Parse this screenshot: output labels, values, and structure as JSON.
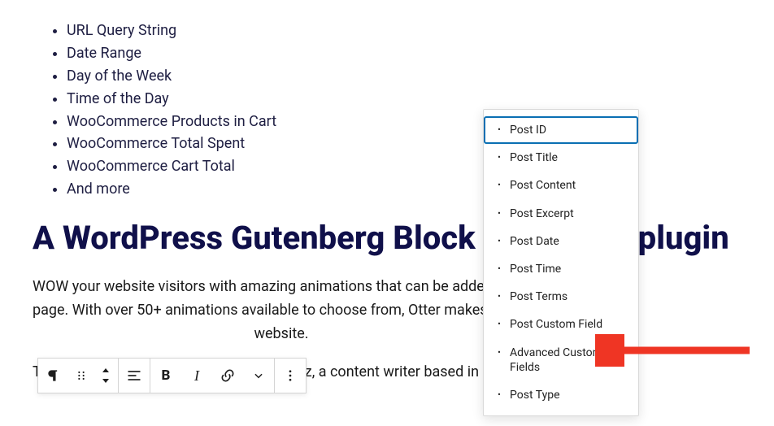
{
  "features": [
    "URL Query String",
    "Date Range",
    "Day of the Week",
    "Time of the Day",
    "WooCommerce Products in Cart",
    "WooCommerce Total Spent",
    "WooCommerce Cart Total",
    "And more"
  ],
  "heading": "A WordPress Gutenberg Block animation plugin",
  "para_line1": "WOW your website visitors with amazing animations that can be added ",
  "para_line2": "page. With over 50+ animations available to choose from, Otter makes i",
  "para_line3": "website.",
  "para2": "This article was written by Pablo Rodriguez, a content writer based in %",
  "toolbar": {
    "block_type": "Paragraph",
    "drag": "Drag",
    "move": "Move up/down",
    "align": "Align",
    "bold": "B",
    "italic": "I",
    "link": "Link",
    "more_rich": "More rich text",
    "options": "Options"
  },
  "popover": {
    "items": [
      "Post ID",
      "Post Title",
      "Post Content",
      "Post Excerpt",
      "Post Date",
      "Post Time",
      "Post Terms",
      "Post Custom Field",
      "Advanced Custom Fields",
      "Post Type"
    ],
    "selected_index": 0,
    "arrow_index": 8
  },
  "colors": {
    "heading": "#10104a",
    "selection": "#0a6fb3",
    "arrow": "#ef3524"
  }
}
